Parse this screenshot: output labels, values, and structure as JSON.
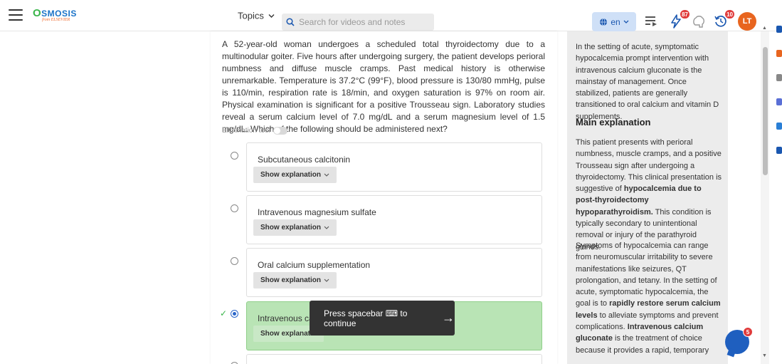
{
  "header": {
    "logo_text": "SMOSIS",
    "logo_letter": "O",
    "logo_sub": "from ELSEVIER",
    "topics_label": "Topics",
    "search_placeholder": "Search for videos and notes",
    "language": "en",
    "lightning_badge": "87",
    "history_badge": "10",
    "avatar_initials": "LT"
  },
  "question": {
    "stem": "A 52-year-old woman undergoes a scheduled total thyroidectomy due to a multinodular goiter. Five hours after undergoing surgery, the patient develops perioral numbness and diffuse muscle cramps. Past medical history is otherwise unremarkable. Temperature is 37.2°C (99°F), blood pressure is 130/80 mmHg, pulse is 110/min, respiration rate is 18/min, and oxygen saturation is 97% on room air. Physical examination is significant for a positive Trousseau sign. Laboratory studies reveal a serum calcium level of 7.0 mg/dL and a serum magnesium level of 1.5 mg/dL. Which of the following should be administered next?",
    "elimination_tool_label": "Elimination tool",
    "options": [
      {
        "label": "Subcutaneous calcitonin",
        "button": "Show explanation"
      },
      {
        "label": "Intravenous magnesium sulfate",
        "button": "Show explanation"
      },
      {
        "label": "Oral calcium supplementation",
        "button": "Show explanation"
      },
      {
        "label": "Intravenous calc",
        "button": "Show explanatio"
      }
    ]
  },
  "toast": {
    "text": "Press spacebar ⌨ to continue",
    "arrow": "→"
  },
  "explanation": {
    "intro": "In the setting of acute, symptomatic hypocalcemia prompt intervention with intravenous calcium gluconate is the mainstay of management. Once stabilized, patients are generally transitioned to oral calcium and vitamin D supplements.",
    "main_heading": "Main explanation",
    "p1_a": "This patient presents with perioral numbness, muscle cramps, and a positive Trousseau sign after undergoing a thyroidectomy. This clinical presentation is suggestive of ",
    "p1_b": "hypocalcemia due to post-thyroidectomy hypoparathyroidism.",
    "p1_c": " This condition is typically secondary to unintentional removal or injury of the parathyroid glands.",
    "p2_a": "Symptoms of hypocalcemia can range from neuromuscular irritability to severe manifestations like seizures, QT prolongation, and tetany. In the setting of acute, symptomatic hypocalcemia, the goal is to ",
    "p2_b": "rapidly restore serum calcium levels",
    "p2_c": " to alleviate symptoms and prevent complications. ",
    "p2_d": "Intravenous calcium gluconate",
    "p2_e": " is the treatment of choice because it provides a rapid, temporary"
  },
  "chat_badge": "5",
  "colors": {
    "correct_bg": "#b9e4b5",
    "accent_blue": "#1a73c8",
    "badge_red": "#e03b3b",
    "avatar_orange": "#e8651f"
  }
}
